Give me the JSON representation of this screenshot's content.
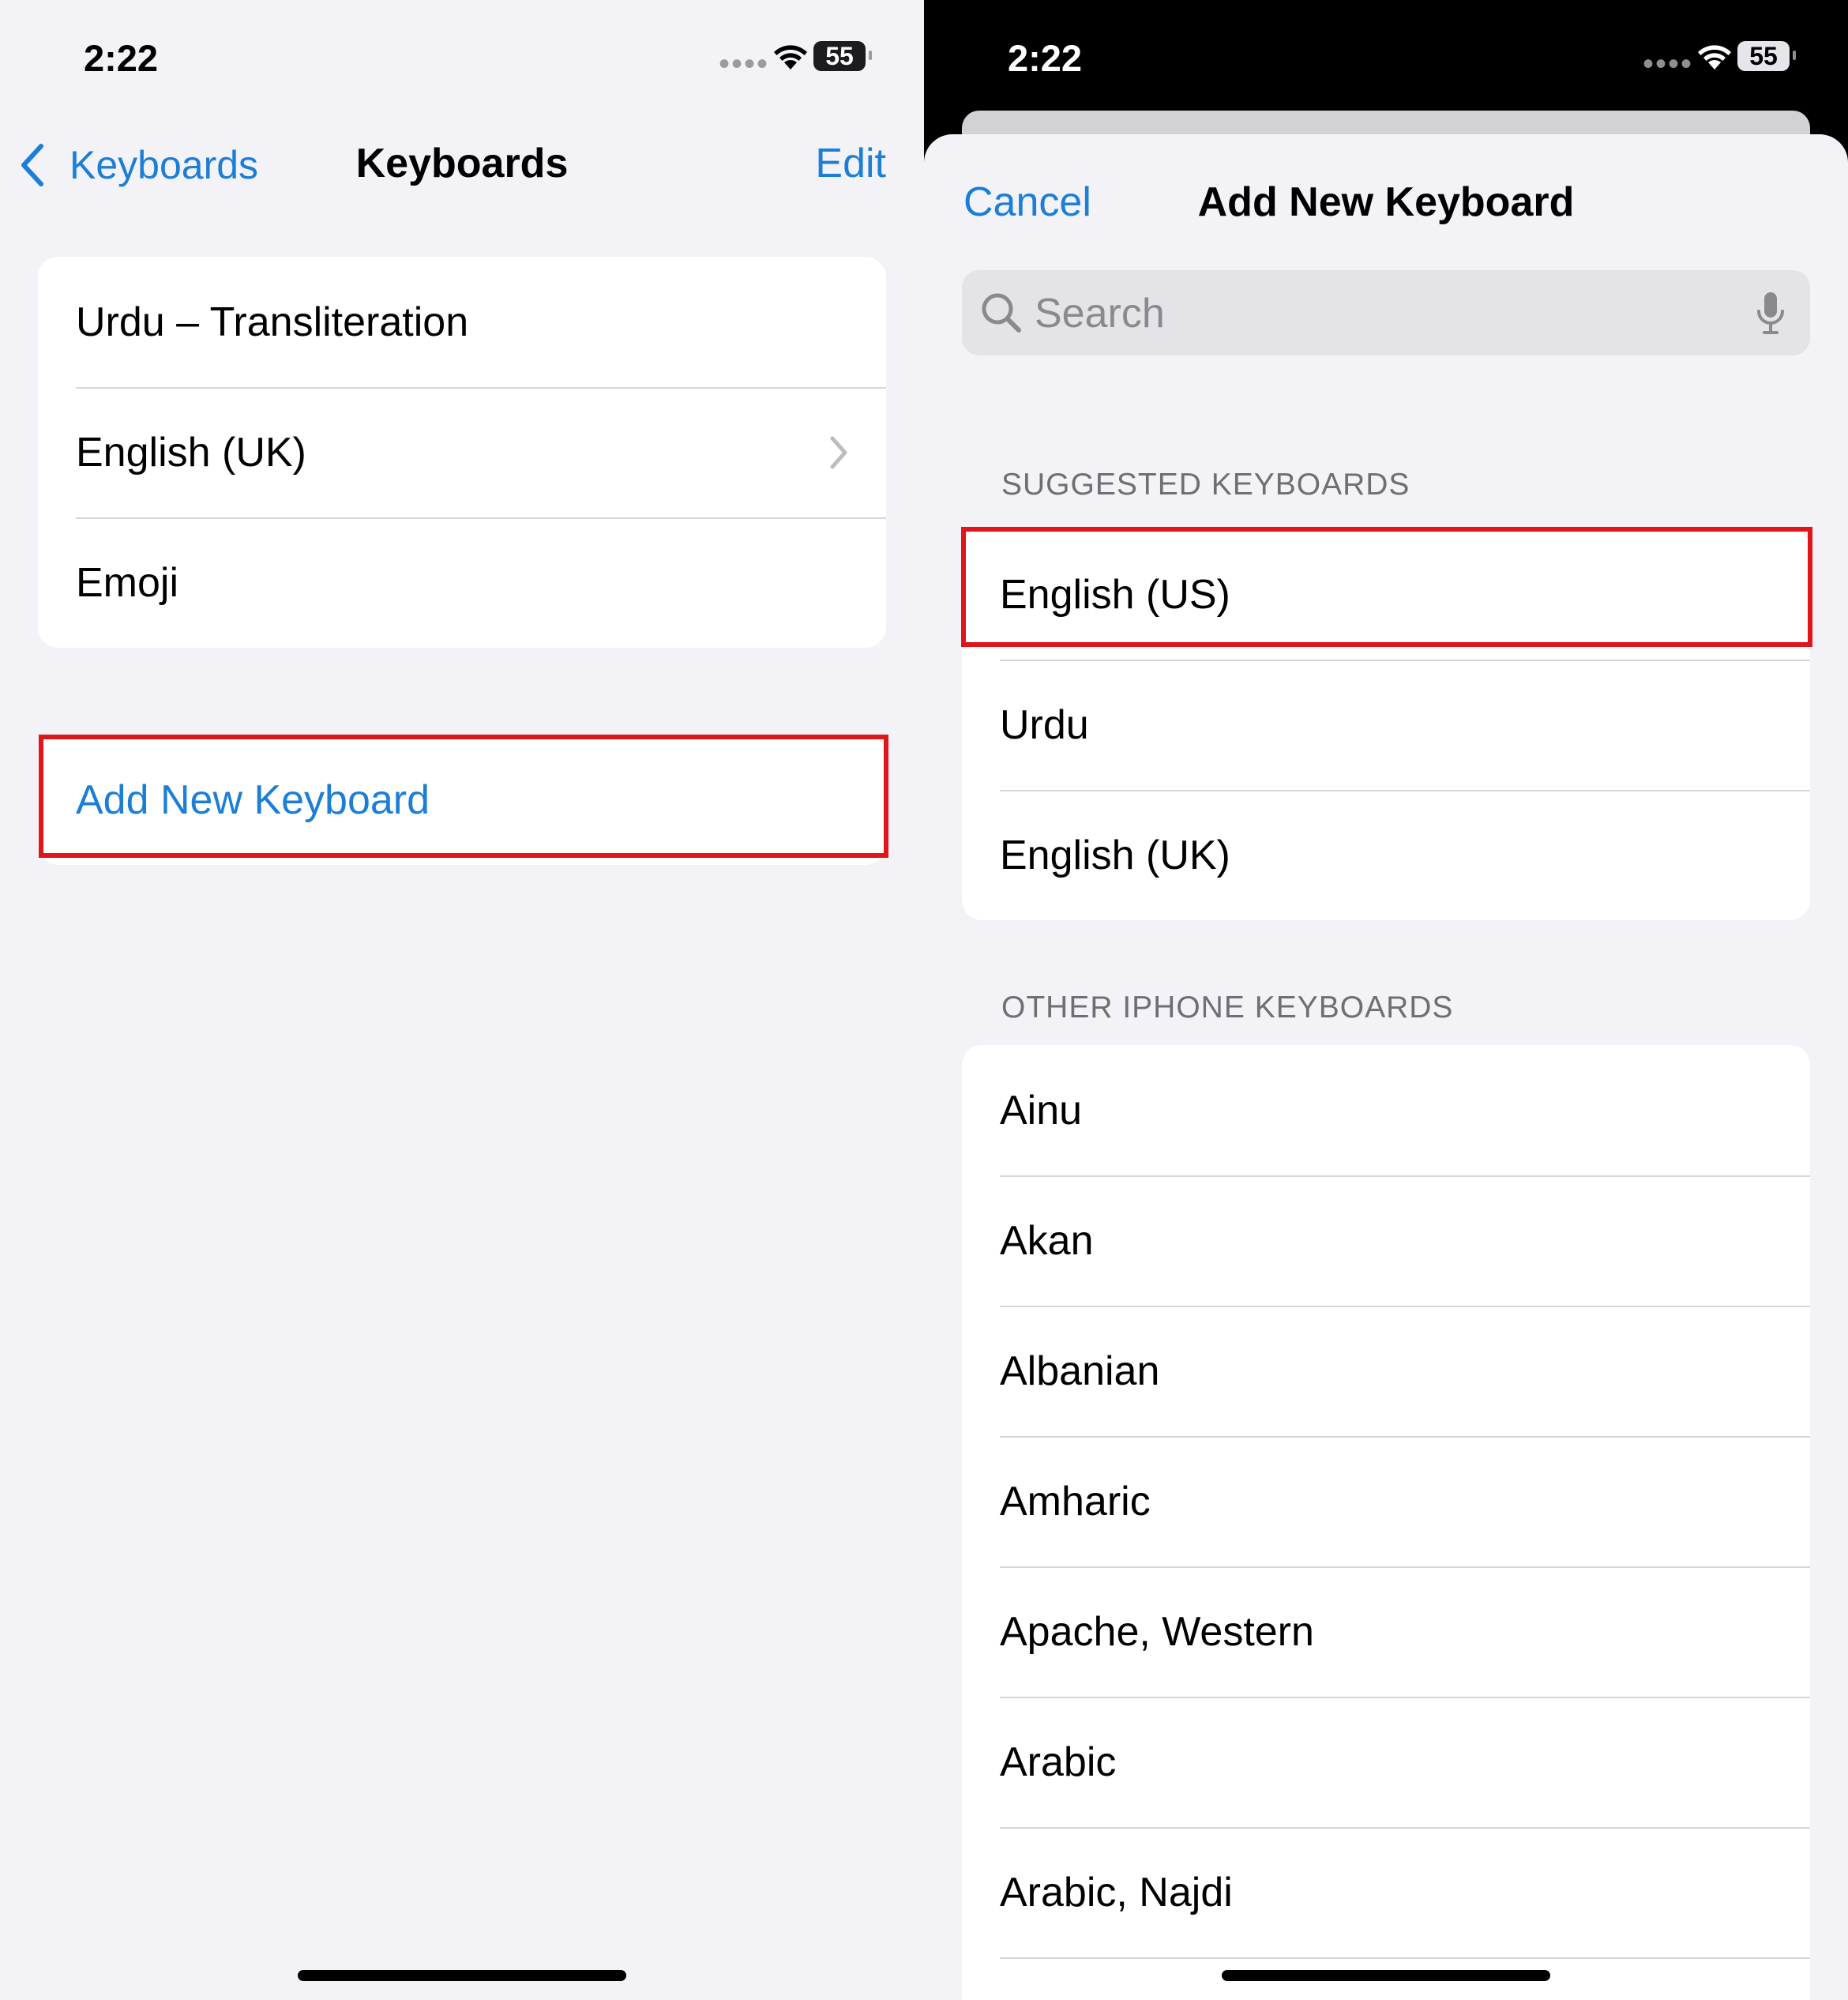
{
  "left": {
    "status": {
      "time": "2:22",
      "battery": "55"
    },
    "nav": {
      "back_label": "Keyboards",
      "title": "Keyboards",
      "edit_label": "Edit"
    },
    "keyboards": [
      "Urdu – Transliteration",
      "English (UK)",
      "Emoji"
    ],
    "add_new_keyboard": "Add New Keyboard"
  },
  "right": {
    "status": {
      "time": "2:22",
      "battery": "55"
    },
    "sheet": {
      "cancel_label": "Cancel",
      "title": "Add New Keyboard",
      "search_placeholder": "Search",
      "suggested_header": "SUGGESTED KEYBOARDS",
      "suggested": [
        "English (US)",
        "Urdu",
        "English (UK)"
      ],
      "other_header": "OTHER IPHONE KEYBOARDS",
      "other": [
        "Ainu",
        "Akan",
        "Albanian",
        "Amharic",
        "Apache, Western",
        "Arabic",
        "Arabic, Najdi"
      ]
    }
  },
  "colors": {
    "accent": "#1c7ed6",
    "highlight": "#e0141b"
  }
}
